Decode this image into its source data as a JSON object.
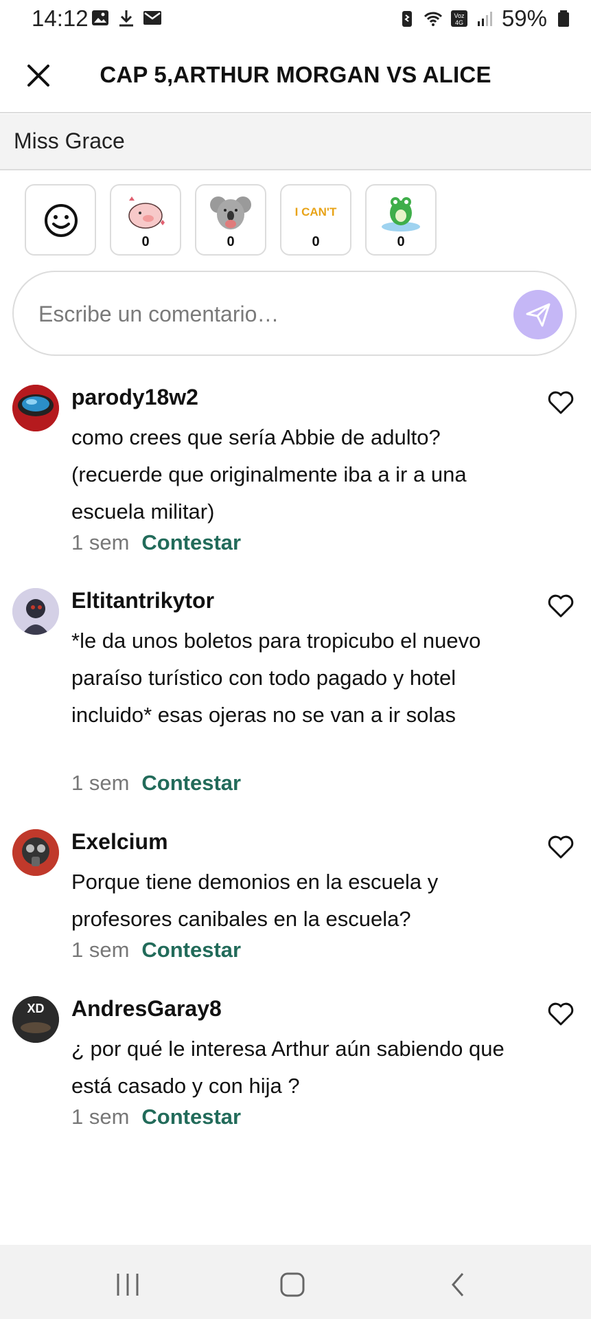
{
  "status_bar": {
    "time": "14:12",
    "battery": "59%"
  },
  "header": {
    "title": "CAP 5,ARTHUR MORGAN VS ALICE"
  },
  "section": {
    "author": "Miss Grace"
  },
  "reactions": [
    {
      "name": "pig-sticker",
      "count": "0"
    },
    {
      "name": "koala-sticker",
      "count": "0"
    },
    {
      "name": "i-cant-sticker",
      "text": "I CAN'T",
      "count": "0"
    },
    {
      "name": "frog-sticker",
      "count": "0"
    }
  ],
  "comment_input": {
    "placeholder": "Escribe un comentario…"
  },
  "comments": [
    {
      "username": "parody18w2",
      "text": "como crees que sería Abbie de adulto? (recuerde que originalmente iba a ir a una escuela militar)",
      "time": "1 sem",
      "reply": "Contestar"
    },
    {
      "username": "Eltitantrikytor",
      "text": "*le da unos boletos para tropicubo el nuevo paraíso turístico con todo pagado y hotel incluido* esas ojeras no se van a ir solas",
      "time": "1 sem",
      "reply": "Contestar"
    },
    {
      "username": "Exelcium",
      "text": "Porque tiene demonios en la escuela y profesores canibales en la escuela?",
      "time": "1 sem",
      "reply": "Contestar"
    },
    {
      "username": "AndresGaray8",
      "avatar_text": "XD",
      "text": "¿ por qué le interesa Arthur aún sabiendo que está casado y con hija ?",
      "time": "1 sem",
      "reply": "Contestar"
    }
  ],
  "colors": {
    "accent": "#226b5a",
    "send_button": "#c5b7f6",
    "nav_bg": "#f2f2f2"
  }
}
